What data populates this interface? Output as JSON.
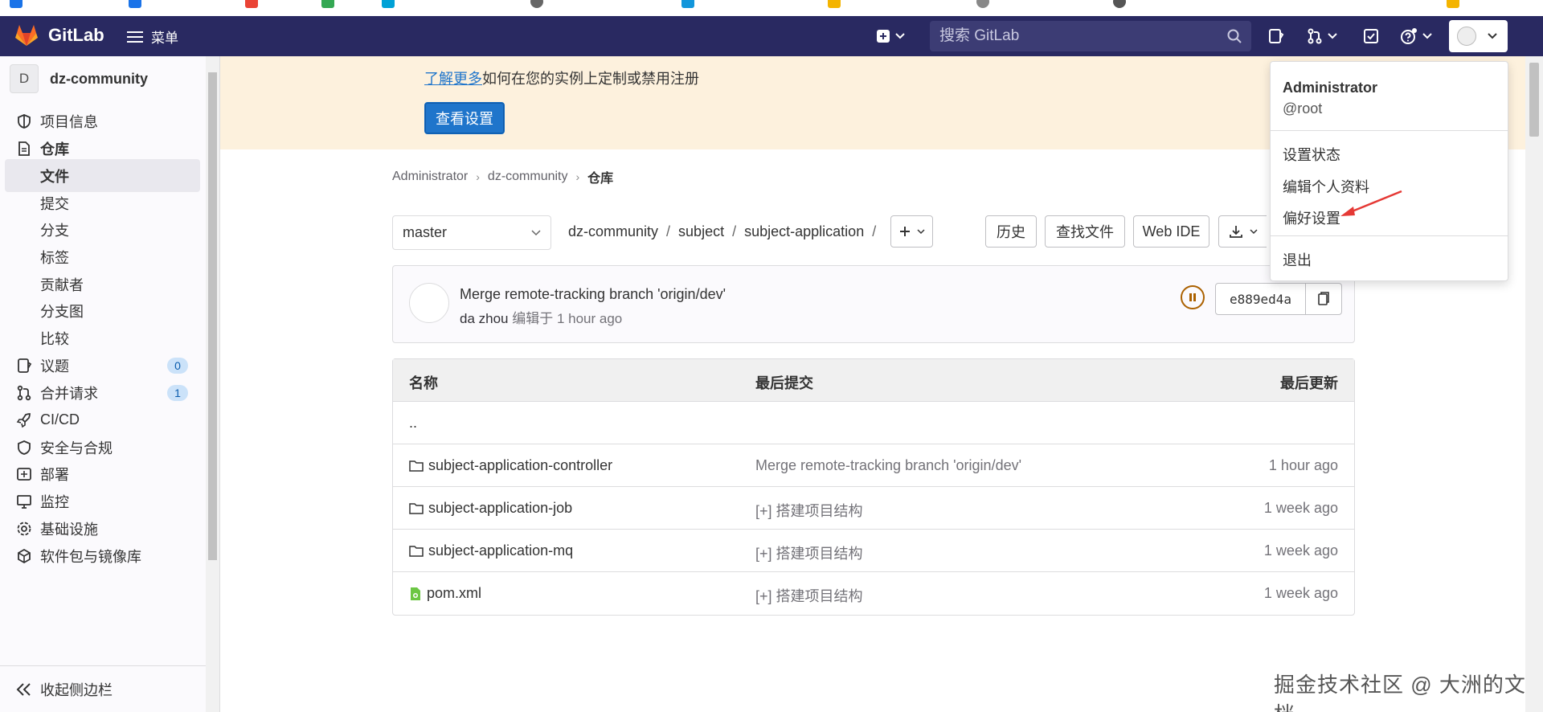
{
  "navbar": {
    "logo_text": "GitLab",
    "menu_label": "菜单",
    "search_placeholder": "搜索 GitLab"
  },
  "sidebar": {
    "project_initial": "D",
    "project_name": "dz-community",
    "items": [
      {
        "label": "项目信息"
      },
      {
        "label": "仓库"
      },
      {
        "label": "文件"
      },
      {
        "label": "提交"
      },
      {
        "label": "分支"
      },
      {
        "label": "标签"
      },
      {
        "label": "贡献者"
      },
      {
        "label": "分支图"
      },
      {
        "label": "比较"
      },
      {
        "label": "议题",
        "badge": "0"
      },
      {
        "label": "合并请求",
        "badge": "1"
      },
      {
        "label": "CI/CD"
      },
      {
        "label": "安全与合规"
      },
      {
        "label": "部署"
      },
      {
        "label": "监控"
      },
      {
        "label": "基础设施"
      },
      {
        "label": "软件包与镜像库"
      }
    ],
    "collapse_label": "收起侧边栏"
  },
  "banner": {
    "learn_more_link": "了解更多",
    "text": "如何在您的实例上定制或禁用注册",
    "button_label": "查看设置"
  },
  "breadcrumb": [
    "Administrator",
    "dz-community",
    "仓库"
  ],
  "repo_toolbar": {
    "branch": "master",
    "path": [
      "dz-community",
      "subject",
      "subject-application"
    ],
    "history_button": "历史",
    "find_file_button": "查找文件",
    "web_ide_button": "Web IDE"
  },
  "last_commit": {
    "title": "Merge remote-tracking branch 'origin/dev'",
    "author": "da zhou",
    "action": "编辑于",
    "time": "1 hour ago",
    "sha": "e889ed4a"
  },
  "file_table": {
    "headers": {
      "name": "名称",
      "last_commit": "最后提交",
      "last_update": "最后更新"
    },
    "parent": "..",
    "rows": [
      {
        "type": "folder",
        "name": "subject-application-controller",
        "commit": "Merge remote-tracking branch 'origin/dev'",
        "updated": "1 hour ago"
      },
      {
        "type": "folder",
        "name": "subject-application-job",
        "commit": "[+] 搭建项目结构",
        "updated": "1 week ago"
      },
      {
        "type": "folder",
        "name": "subject-application-mq",
        "commit": "[+] 搭建项目结构",
        "updated": "1 week ago"
      },
      {
        "type": "file",
        "name": "pom.xml",
        "commit": "[+] 搭建项目结构",
        "updated": "1 week ago"
      }
    ]
  },
  "user_dropdown": {
    "name": "Administrator",
    "username": "@root",
    "items": [
      "设置状态",
      "编辑个人资料",
      "偏好设置"
    ],
    "sign_out": "退出"
  },
  "watermark": "掘金技术社区 @ 大洲的文档",
  "colors": {
    "navbar": "#292961",
    "primary": "#1f75cb",
    "banner": "#fdf1dd",
    "arrow": "#e53935"
  }
}
